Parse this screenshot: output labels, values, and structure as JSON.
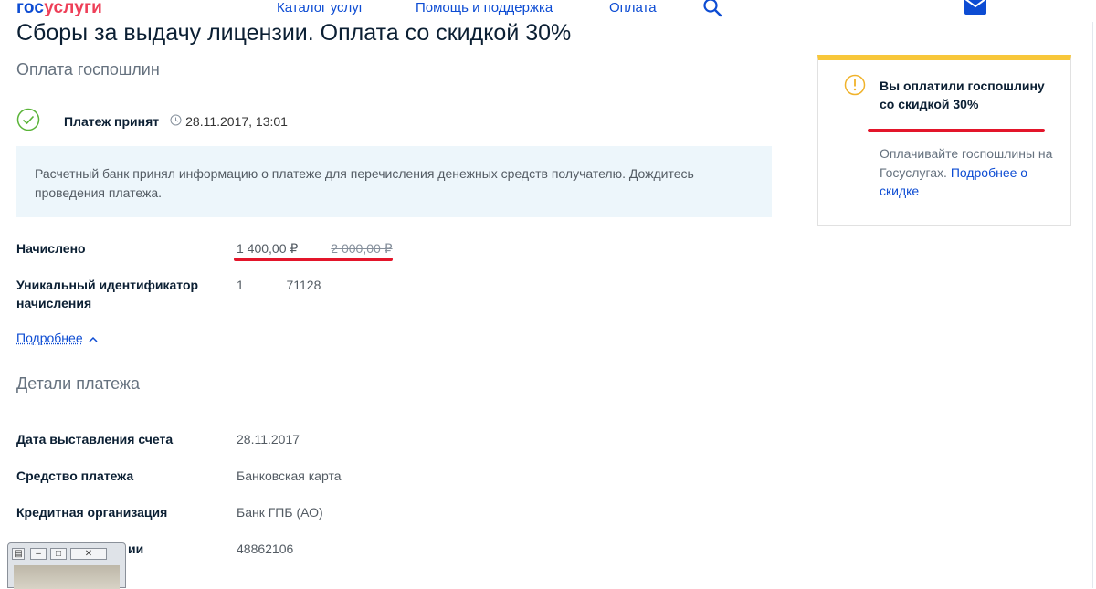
{
  "header": {
    "logo_part1": "гос",
    "logo_part2": "услуги",
    "nav": [
      "Каталог услуг",
      "Помощь и поддержка",
      "Оплата"
    ]
  },
  "page": {
    "title": "Сборы за выдачу лицензии. Оплата со скидкой 30%",
    "subtitle": "Оплата госпошлин"
  },
  "status": {
    "label": "Платеж принят",
    "datetime": "28.11.2017, 13:01",
    "message": "Расчетный банк принял информацию о платеже для перечисления денежных средств получателю. Дождитесь проведения платежа."
  },
  "charge": {
    "label": "Начислено",
    "amount": "1 400,00 ₽",
    "old_amount": "2 000,00 ₽"
  },
  "uid": {
    "label": "Уникальный идентификатор начисления",
    "value": "1            71128"
  },
  "more_link": "Подробнее",
  "details": {
    "title": "Детали платежа",
    "rows": [
      {
        "label": "Дата выставления счета",
        "value": "28.11.2017"
      },
      {
        "label": "Средство платежа",
        "value": "Банковская карта"
      },
      {
        "label": "Кредитная организация",
        "value": "Банк ГПБ (АО)"
      },
      {
        "label": "ии",
        "value": "48862106"
      }
    ]
  },
  "side_card": {
    "heading": "Вы оплатили госпошлину со скидкой 30%",
    "body": "Оплачивайте госпошлины на Госуслугах.",
    "link": "Подробнее о скидке"
  },
  "colors": {
    "brand_blue": "#0d4cd3",
    "brand_red": "#ee3f58",
    "warning_yellow": "#f8c73a",
    "success_green": "#5ab438",
    "highlight_red": "#e3152a"
  },
  "icons": [
    "search-icon",
    "mail-icon",
    "check-circle-icon",
    "clock-icon",
    "warning-icon",
    "chevron-up-icon"
  ]
}
